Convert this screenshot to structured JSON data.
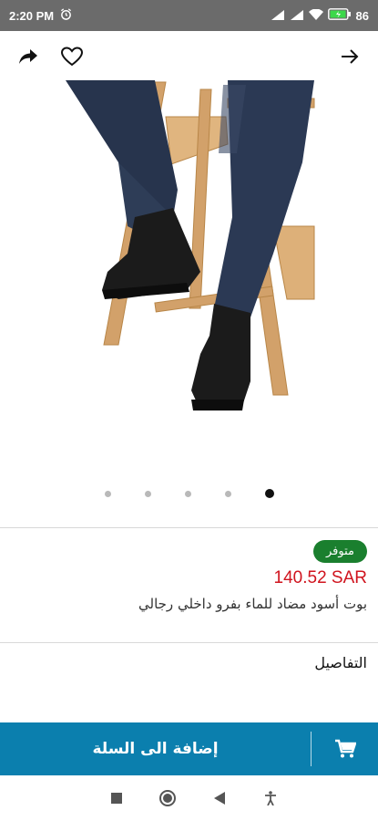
{
  "status_bar": {
    "time": "2:20 PM",
    "battery": "86",
    "icons": [
      "alarm-icon",
      "signal-icon",
      "signal-icon",
      "wifi-icon",
      "battery-icon"
    ]
  },
  "top_bar": {
    "icons": [
      "share-icon",
      "heart-icon",
      "back-arrow-icon"
    ]
  },
  "gallery": {
    "image_count": 5,
    "active_index": 4
  },
  "product": {
    "availability": "متوفر",
    "price": "140.52 SAR",
    "title": "بوت أسود مضاد للماء بفرو داخلي رجالي"
  },
  "details": {
    "label": "التفاصيل"
  },
  "cart_bar": {
    "add_label": "إضافة الى السلة",
    "icon": "cart-icon"
  },
  "nav_bar": {
    "icons": [
      "recent-apps-icon",
      "home-icon",
      "back-icon",
      "accessibility-icon"
    ]
  },
  "colors": {
    "accent": "#0b7fae",
    "price": "#d0141e",
    "badge": "#1a7f2e"
  }
}
